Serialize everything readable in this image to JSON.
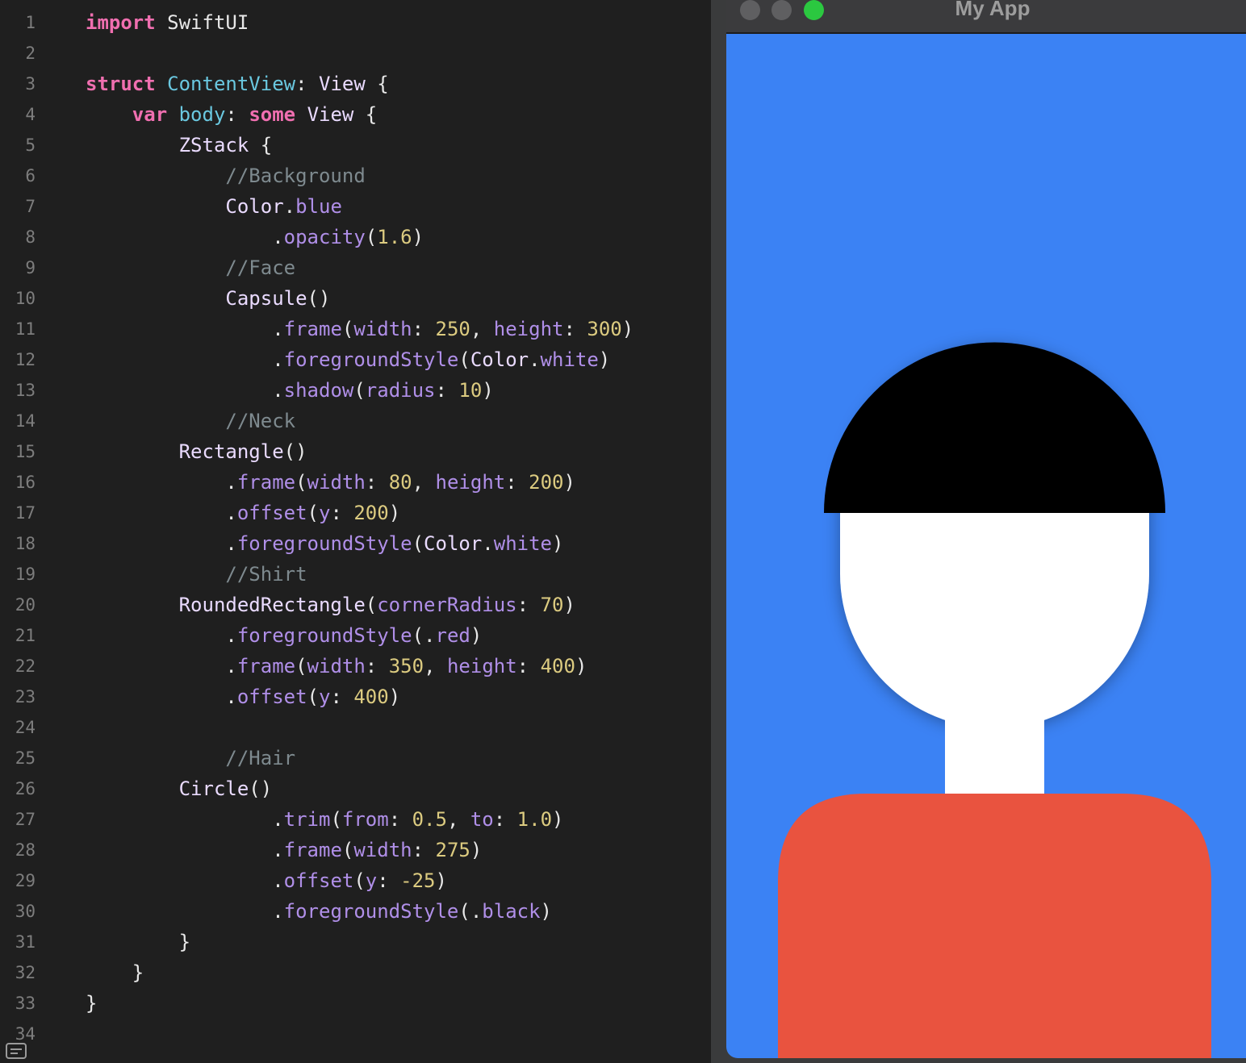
{
  "editor": {
    "lines": [
      {
        "n": "1",
        "tokens": [
          [
            "kw",
            "import"
          ],
          [
            "plain",
            " SwiftUI"
          ]
        ]
      },
      {
        "n": "2",
        "tokens": []
      },
      {
        "n": "3",
        "tokens": [
          [
            "kw",
            "struct"
          ],
          [
            "plain",
            " "
          ],
          [
            "decl",
            "ContentView"
          ],
          [
            "plain",
            ": "
          ],
          [
            "type",
            "View"
          ],
          [
            "plain",
            " {"
          ]
        ]
      },
      {
        "n": "4",
        "tokens": [
          [
            "plain",
            "    "
          ],
          [
            "kw",
            "var"
          ],
          [
            "plain",
            " "
          ],
          [
            "decl",
            "body"
          ],
          [
            "plain",
            ": "
          ],
          [
            "kw",
            "some"
          ],
          [
            "plain",
            " "
          ],
          [
            "type",
            "View"
          ],
          [
            "plain",
            " {"
          ]
        ]
      },
      {
        "n": "5",
        "tokens": [
          [
            "plain",
            "        "
          ],
          [
            "type",
            "ZStack"
          ],
          [
            "plain",
            " {"
          ]
        ]
      },
      {
        "n": "6",
        "tokens": [
          [
            "plain",
            "            "
          ],
          [
            "comment",
            "//Background"
          ]
        ]
      },
      {
        "n": "7",
        "tokens": [
          [
            "plain",
            "            "
          ],
          [
            "type",
            "Color"
          ],
          [
            "plain",
            "."
          ],
          [
            "method",
            "blue"
          ]
        ]
      },
      {
        "n": "8",
        "tokens": [
          [
            "plain",
            "                ."
          ],
          [
            "method",
            "opacity"
          ],
          [
            "plain",
            "("
          ],
          [
            "num",
            "1.6"
          ],
          [
            "plain",
            ")"
          ]
        ]
      },
      {
        "n": "9",
        "tokens": [
          [
            "plain",
            "            "
          ],
          [
            "comment",
            "//Face"
          ]
        ]
      },
      {
        "n": "10",
        "tokens": [
          [
            "plain",
            "            "
          ],
          [
            "type",
            "Capsule"
          ],
          [
            "plain",
            "()"
          ]
        ]
      },
      {
        "n": "11",
        "tokens": [
          [
            "plain",
            "                ."
          ],
          [
            "method",
            "frame"
          ],
          [
            "plain",
            "("
          ],
          [
            "method",
            "width"
          ],
          [
            "plain",
            ": "
          ],
          [
            "num",
            "250"
          ],
          [
            "plain",
            ", "
          ],
          [
            "method",
            "height"
          ],
          [
            "plain",
            ": "
          ],
          [
            "num",
            "300"
          ],
          [
            "plain",
            ")"
          ]
        ]
      },
      {
        "n": "12",
        "tokens": [
          [
            "plain",
            "                ."
          ],
          [
            "method",
            "foregroundStyle"
          ],
          [
            "plain",
            "("
          ],
          [
            "type",
            "Color"
          ],
          [
            "plain",
            "."
          ],
          [
            "method",
            "white"
          ],
          [
            "plain",
            ")"
          ]
        ]
      },
      {
        "n": "13",
        "tokens": [
          [
            "plain",
            "                ."
          ],
          [
            "method",
            "shadow"
          ],
          [
            "plain",
            "("
          ],
          [
            "method",
            "radius"
          ],
          [
            "plain",
            ": "
          ],
          [
            "num",
            "10"
          ],
          [
            "plain",
            ")"
          ]
        ]
      },
      {
        "n": "14",
        "tokens": [
          [
            "plain",
            "            "
          ],
          [
            "comment",
            "//Neck"
          ]
        ]
      },
      {
        "n": "15",
        "tokens": [
          [
            "plain",
            "        "
          ],
          [
            "type",
            "Rectangle"
          ],
          [
            "plain",
            "()"
          ]
        ]
      },
      {
        "n": "16",
        "tokens": [
          [
            "plain",
            "            ."
          ],
          [
            "method",
            "frame"
          ],
          [
            "plain",
            "("
          ],
          [
            "method",
            "width"
          ],
          [
            "plain",
            ": "
          ],
          [
            "num",
            "80"
          ],
          [
            "plain",
            ", "
          ],
          [
            "method",
            "height"
          ],
          [
            "plain",
            ": "
          ],
          [
            "num",
            "200"
          ],
          [
            "plain",
            ")"
          ]
        ]
      },
      {
        "n": "17",
        "tokens": [
          [
            "plain",
            "            ."
          ],
          [
            "method",
            "offset"
          ],
          [
            "plain",
            "("
          ],
          [
            "method",
            "y"
          ],
          [
            "plain",
            ": "
          ],
          [
            "num",
            "200"
          ],
          [
            "plain",
            ")"
          ]
        ]
      },
      {
        "n": "18",
        "tokens": [
          [
            "plain",
            "            ."
          ],
          [
            "method",
            "foregroundStyle"
          ],
          [
            "plain",
            "("
          ],
          [
            "type",
            "Color"
          ],
          [
            "plain",
            "."
          ],
          [
            "method",
            "white"
          ],
          [
            "plain",
            ")"
          ]
        ]
      },
      {
        "n": "19",
        "tokens": [
          [
            "plain",
            "            "
          ],
          [
            "comment",
            "//Shirt"
          ]
        ]
      },
      {
        "n": "20",
        "tokens": [
          [
            "plain",
            "        "
          ],
          [
            "type",
            "RoundedRectangle"
          ],
          [
            "plain",
            "("
          ],
          [
            "method",
            "cornerRadius"
          ],
          [
            "plain",
            ": "
          ],
          [
            "num",
            "70"
          ],
          [
            "plain",
            ")"
          ]
        ]
      },
      {
        "n": "21",
        "tokens": [
          [
            "plain",
            "            ."
          ],
          [
            "method",
            "foregroundStyle"
          ],
          [
            "plain",
            "(."
          ],
          [
            "method",
            "red"
          ],
          [
            "plain",
            ")"
          ]
        ]
      },
      {
        "n": "22",
        "tokens": [
          [
            "plain",
            "            ."
          ],
          [
            "method",
            "frame"
          ],
          [
            "plain",
            "("
          ],
          [
            "method",
            "width"
          ],
          [
            "plain",
            ": "
          ],
          [
            "num",
            "350"
          ],
          [
            "plain",
            ", "
          ],
          [
            "method",
            "height"
          ],
          [
            "plain",
            ": "
          ],
          [
            "num",
            "400"
          ],
          [
            "plain",
            ")"
          ]
        ]
      },
      {
        "n": "23",
        "tokens": [
          [
            "plain",
            "            ."
          ],
          [
            "method",
            "offset"
          ],
          [
            "plain",
            "("
          ],
          [
            "method",
            "y"
          ],
          [
            "plain",
            ": "
          ],
          [
            "num",
            "400"
          ],
          [
            "plain",
            ")"
          ]
        ]
      },
      {
        "n": "24",
        "tokens": []
      },
      {
        "n": "25",
        "tokens": [
          [
            "plain",
            "            "
          ],
          [
            "comment",
            "//Hair"
          ]
        ]
      },
      {
        "n": "26",
        "tokens": [
          [
            "plain",
            "        "
          ],
          [
            "type",
            "Circle"
          ],
          [
            "plain",
            "()"
          ]
        ]
      },
      {
        "n": "27",
        "tokens": [
          [
            "plain",
            "                ."
          ],
          [
            "method",
            "trim"
          ],
          [
            "plain",
            "("
          ],
          [
            "method",
            "from"
          ],
          [
            "plain",
            ": "
          ],
          [
            "num",
            "0.5"
          ],
          [
            "plain",
            ", "
          ],
          [
            "method",
            "to"
          ],
          [
            "plain",
            ": "
          ],
          [
            "num",
            "1.0"
          ],
          [
            "plain",
            ")"
          ]
        ]
      },
      {
        "n": "28",
        "tokens": [
          [
            "plain",
            "                ."
          ],
          [
            "method",
            "frame"
          ],
          [
            "plain",
            "("
          ],
          [
            "method",
            "width"
          ],
          [
            "plain",
            ": "
          ],
          [
            "num",
            "275"
          ],
          [
            "plain",
            ")"
          ]
        ]
      },
      {
        "n": "29",
        "tokens": [
          [
            "plain",
            "                ."
          ],
          [
            "method",
            "offset"
          ],
          [
            "plain",
            "("
          ],
          [
            "method",
            "y"
          ],
          [
            "plain",
            ": "
          ],
          [
            "num",
            "-25"
          ],
          [
            "plain",
            ")"
          ]
        ]
      },
      {
        "n": "30",
        "tokens": [
          [
            "plain",
            "                ."
          ],
          [
            "method",
            "foregroundStyle"
          ],
          [
            "plain",
            "(."
          ],
          [
            "method",
            "black"
          ],
          [
            "plain",
            ")"
          ]
        ]
      },
      {
        "n": "31",
        "tokens": [
          [
            "plain",
            "        }"
          ]
        ]
      },
      {
        "n": "32",
        "tokens": [
          [
            "plain",
            "    }"
          ]
        ]
      },
      {
        "n": "33",
        "tokens": [
          [
            "plain",
            "}"
          ]
        ]
      },
      {
        "n": "34",
        "tokens": []
      }
    ]
  },
  "preview": {
    "window_title": "My App",
    "traffic_lights": [
      {
        "name": "close",
        "color": "#5f5f61"
      },
      {
        "name": "minimize",
        "color": "#5f5f61"
      },
      {
        "name": "zoom",
        "color": "#2bc840"
      }
    ],
    "colors": {
      "background": "#3b82f4",
      "face": "#ffffff",
      "neck": "#ffffff",
      "shirt": "#e9533f",
      "hair": "#000000"
    }
  }
}
